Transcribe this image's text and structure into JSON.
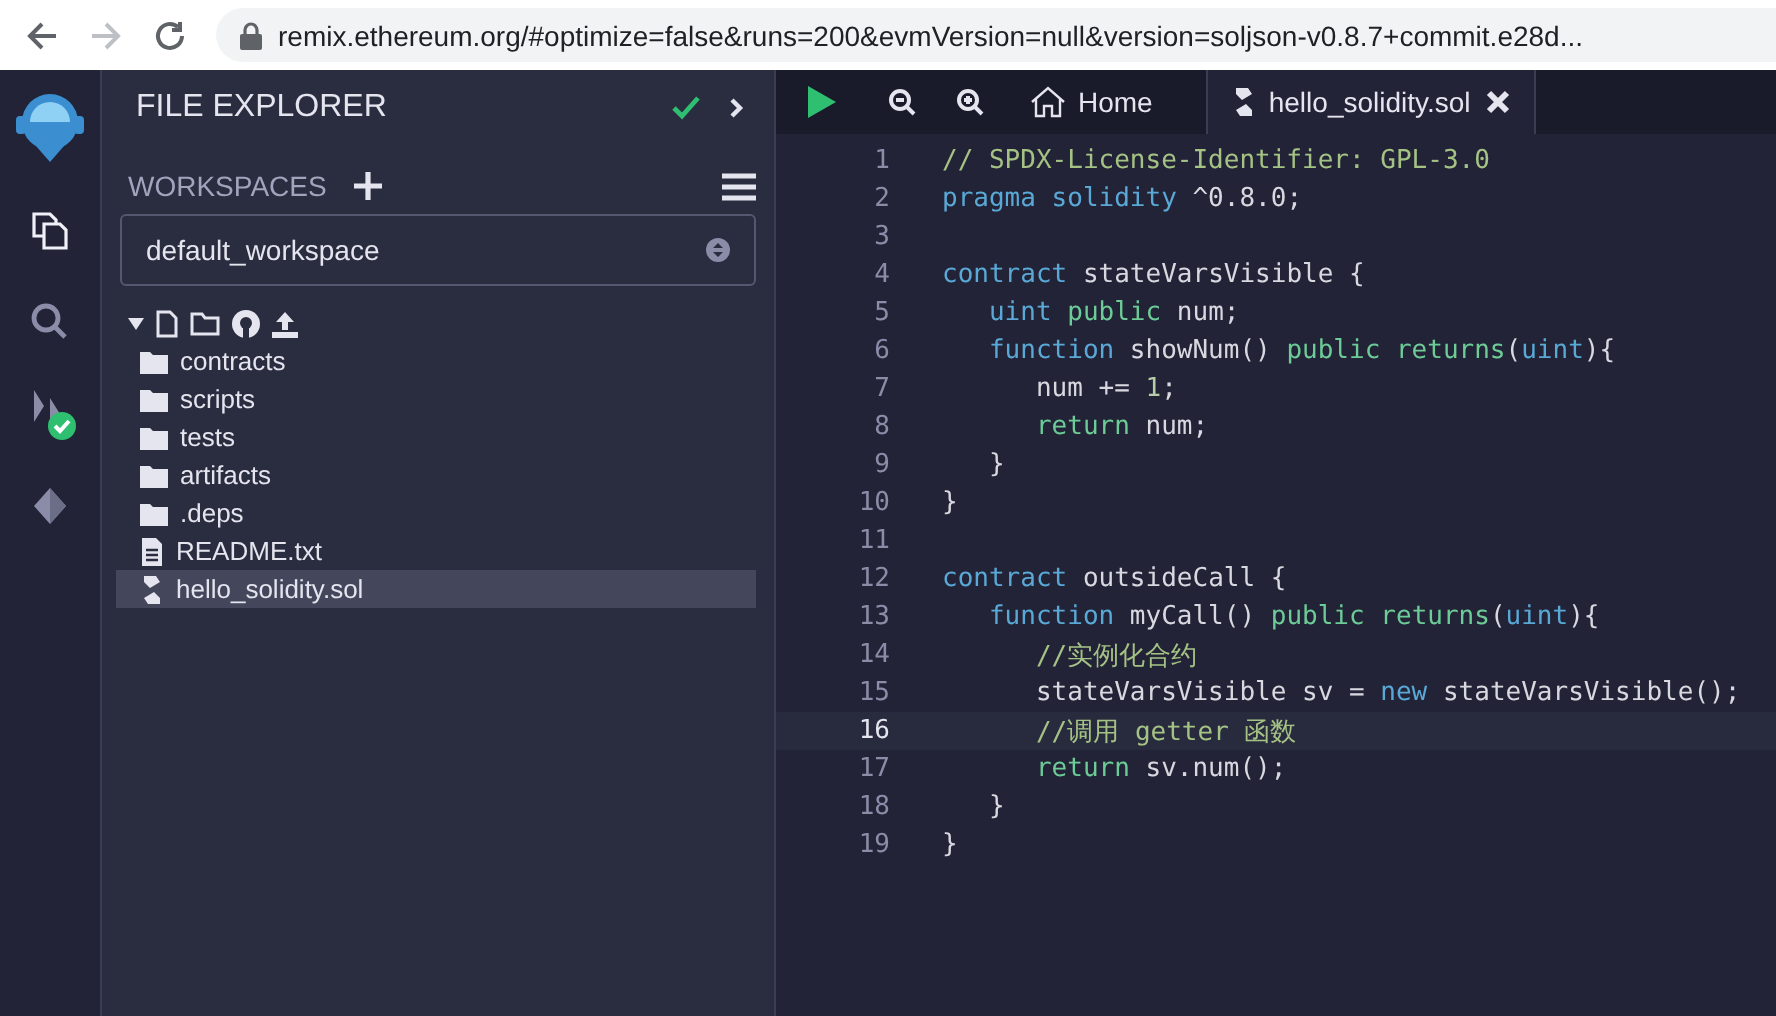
{
  "browser": {
    "url": "remix.ethereum.org/#optimize=false&runs=200&evmVersion=null&version=soljson-v0.8.7+commit.e28d..."
  },
  "icon_panel": {
    "items": [
      {
        "kind": "files",
        "selected": true
      },
      {
        "kind": "search",
        "selected": false
      },
      {
        "kind": "compiler",
        "selected": false
      },
      {
        "kind": "deploy",
        "selected": false
      }
    ]
  },
  "side_panel": {
    "title": "FILE EXPLORER",
    "workspaces_label": "WORKSPACES",
    "workspace": "default_workspace",
    "files": [
      {
        "name": "contracts",
        "kind": "folder",
        "selected": false
      },
      {
        "name": "scripts",
        "kind": "folder",
        "selected": false
      },
      {
        "name": "tests",
        "kind": "folder",
        "selected": false
      },
      {
        "name": "artifacts",
        "kind": "folder",
        "selected": false
      },
      {
        "name": ".deps",
        "kind": "folder",
        "selected": false
      },
      {
        "name": "README.txt",
        "kind": "text",
        "selected": false
      },
      {
        "name": "hello_solidity.sol",
        "kind": "solidity",
        "selected": true
      }
    ]
  },
  "editor": {
    "tabs": [
      {
        "label": "Home",
        "kind": "home",
        "selected": false
      },
      {
        "label": "hello_solidity.sol",
        "kind": "solidity",
        "selected": true
      }
    ],
    "lines": [
      {
        "number": "1",
        "current": false,
        "tokens": [
          {
            "text": "// SPDX-License-Identifier: GPL-3.0",
            "kind": "comment"
          }
        ]
      },
      {
        "number": "2",
        "current": false,
        "tokens": [
          {
            "text": "pragma solidity",
            "kind": "keyword"
          },
          {
            "text": " ^0.8.0;",
            "kind": "plain"
          }
        ]
      },
      {
        "number": "3",
        "current": false
      },
      {
        "number": "4",
        "current": false,
        "tokens": [
          {
            "text": "contract",
            "kind": "keyword"
          },
          {
            "text": " stateVarsVisible {",
            "kind": "plain"
          }
        ]
      },
      {
        "number": "5",
        "current": false,
        "tokens": [
          {
            "text": "   uint",
            "kind": "keyword"
          },
          {
            "text": " public",
            "kind": "modifier"
          },
          {
            "text": " num;",
            "kind": "plain"
          }
        ]
      },
      {
        "number": "6",
        "current": false,
        "tokens": [
          {
            "text": "   function",
            "kind": "keyword"
          },
          {
            "text": " showNum() ",
            "kind": "plain"
          },
          {
            "text": "public returns",
            "kind": "modifier"
          },
          {
            "text": "(",
            "kind": "plain"
          },
          {
            "text": "uint",
            "kind": "keyword"
          },
          {
            "text": "){",
            "kind": "plain"
          }
        ]
      },
      {
        "number": "7",
        "current": false,
        "tokens": [
          {
            "text": "      num += ",
            "kind": "plain"
          },
          {
            "text": "1",
            "kind": "number"
          },
          {
            "text": ";",
            "kind": "plain"
          }
        ]
      },
      {
        "number": "8",
        "current": false,
        "tokens": [
          {
            "text": "      return",
            "kind": "modifier"
          },
          {
            "text": " num;",
            "kind": "plain"
          }
        ]
      },
      {
        "number": "9",
        "current": false,
        "tokens": [
          {
            "text": "   }",
            "kind": "plain"
          }
        ]
      },
      {
        "number": "10",
        "current": false,
        "tokens": [
          {
            "text": "}",
            "kind": "plain"
          }
        ]
      },
      {
        "number": "11",
        "current": false
      },
      {
        "number": "12",
        "current": false,
        "tokens": [
          {
            "text": "contract",
            "kind": "keyword"
          },
          {
            "text": " outsideCall {",
            "kind": "plain"
          }
        ]
      },
      {
        "number": "13",
        "current": false,
        "tokens": [
          {
            "text": "   function",
            "kind": "keyword"
          },
          {
            "text": " myCall() ",
            "kind": "plain"
          },
          {
            "text": "public returns",
            "kind": "modifier"
          },
          {
            "text": "(",
            "kind": "plain"
          },
          {
            "text": "uint",
            "kind": "keyword"
          },
          {
            "text": "){",
            "kind": "plain"
          }
        ]
      },
      {
        "number": "14",
        "current": false,
        "tokens": [
          {
            "text": "      //实例化合约",
            "kind": "comment"
          }
        ]
      },
      {
        "number": "15",
        "current": false,
        "tokens": [
          {
            "text": "      stateVarsVisible sv = ",
            "kind": "plain"
          },
          {
            "text": "new",
            "kind": "keyword"
          },
          {
            "text": " stateVarsVisible();",
            "kind": "plain"
          }
        ]
      },
      {
        "number": "16",
        "current": true,
        "tokens": [
          {
            "text": "      //调用 getter 函数",
            "kind": "comment"
          }
        ]
      },
      {
        "number": "17",
        "current": false,
        "tokens": [
          {
            "text": "      return",
            "kind": "modifier"
          },
          {
            "text": " sv.num();",
            "kind": "plain"
          }
        ]
      },
      {
        "number": "18",
        "current": false,
        "tokens": [
          {
            "text": "   }",
            "kind": "plain"
          }
        ]
      },
      {
        "number": "19",
        "current": false,
        "tokens": [
          {
            "text": "}",
            "kind": "plain"
          }
        ]
      }
    ]
  }
}
